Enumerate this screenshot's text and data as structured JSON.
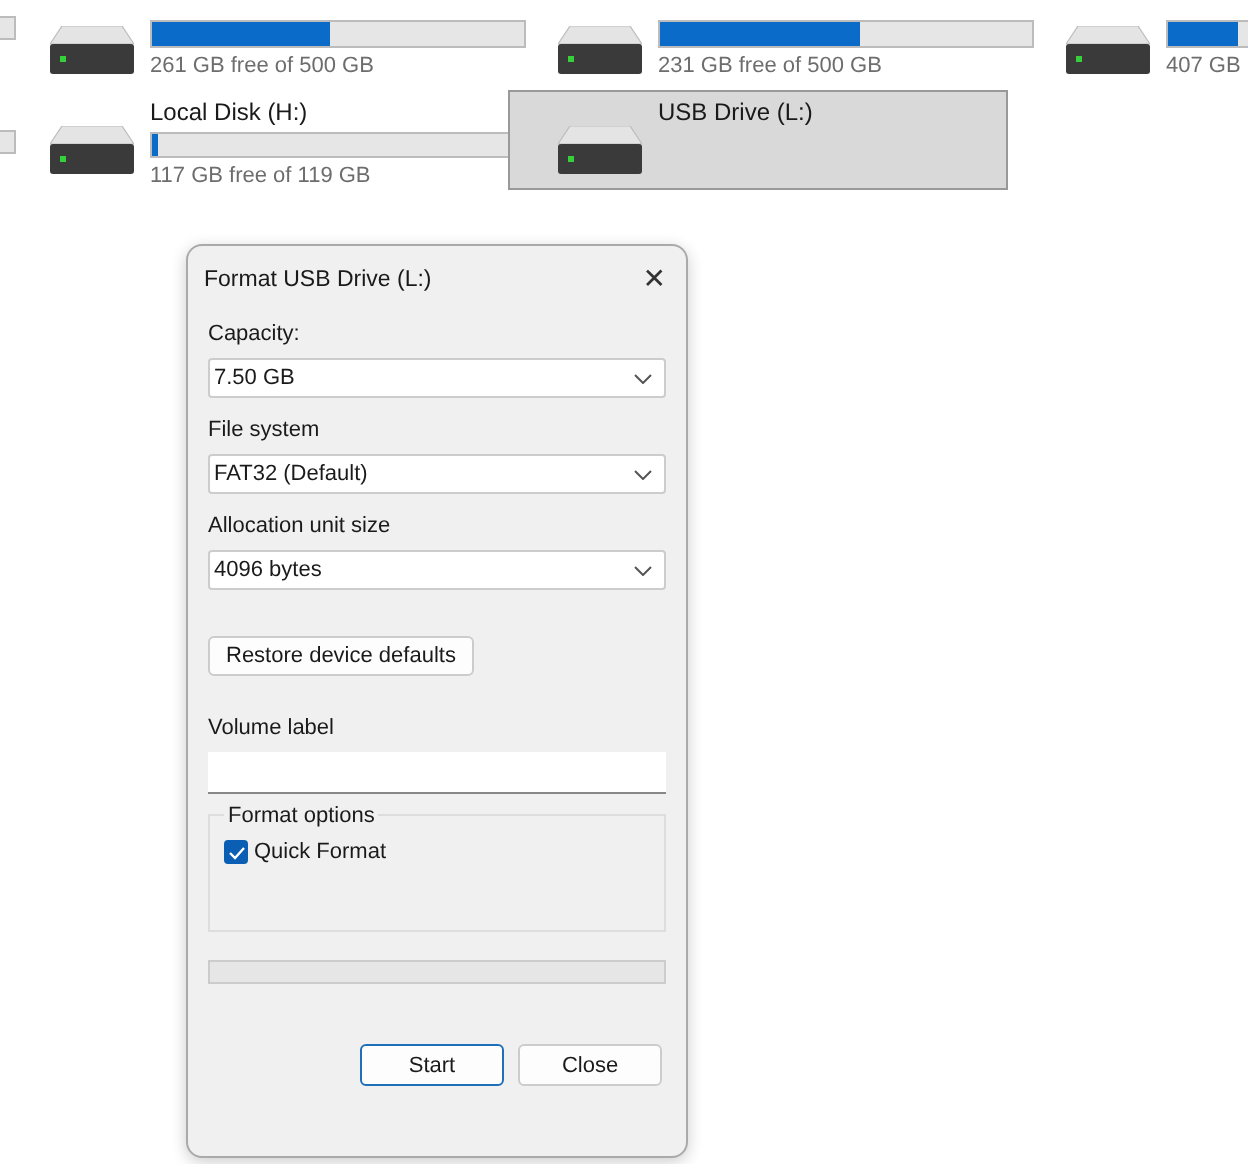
{
  "drive_rows": [
    [
      {
        "free": "261 GB free of 500 GB",
        "level": 0.476,
        "selected": false
      },
      {
        "free": "231 GB free of 500 GB",
        "level": 0.538,
        "selected": false
      },
      {
        "free": "407 GB",
        "level": 0.186,
        "selected": false
      }
    ],
    [
      {
        "name": "Local Disk (H:)",
        "free": "117 GB free of 119 GB",
        "level": 0.017,
        "selected": false
      },
      {
        "name": "USB Drive (L:)",
        "selected": true
      }
    ]
  ],
  "dialog": {
    "title": "Format USB Drive (L:)",
    "close": "✕",
    "fields": [
      {
        "label": "Capacity:",
        "value": "7.50 GB"
      },
      {
        "label": "File system",
        "value": "FAT32 (Default)"
      },
      {
        "label": "Allocation unit size",
        "value": "4096 bytes"
      }
    ],
    "restore_button": "Restore device defaults",
    "volume_label": {
      "label": "Volume label"
    },
    "format_options": {
      "title": "Format options",
      "quick_format": {
        "label": "Quick Format",
        "checked": true
      }
    },
    "buttons": [
      {
        "label": "Start",
        "default": true
      },
      {
        "label": "Close",
        "default": false
      }
    ]
  }
}
